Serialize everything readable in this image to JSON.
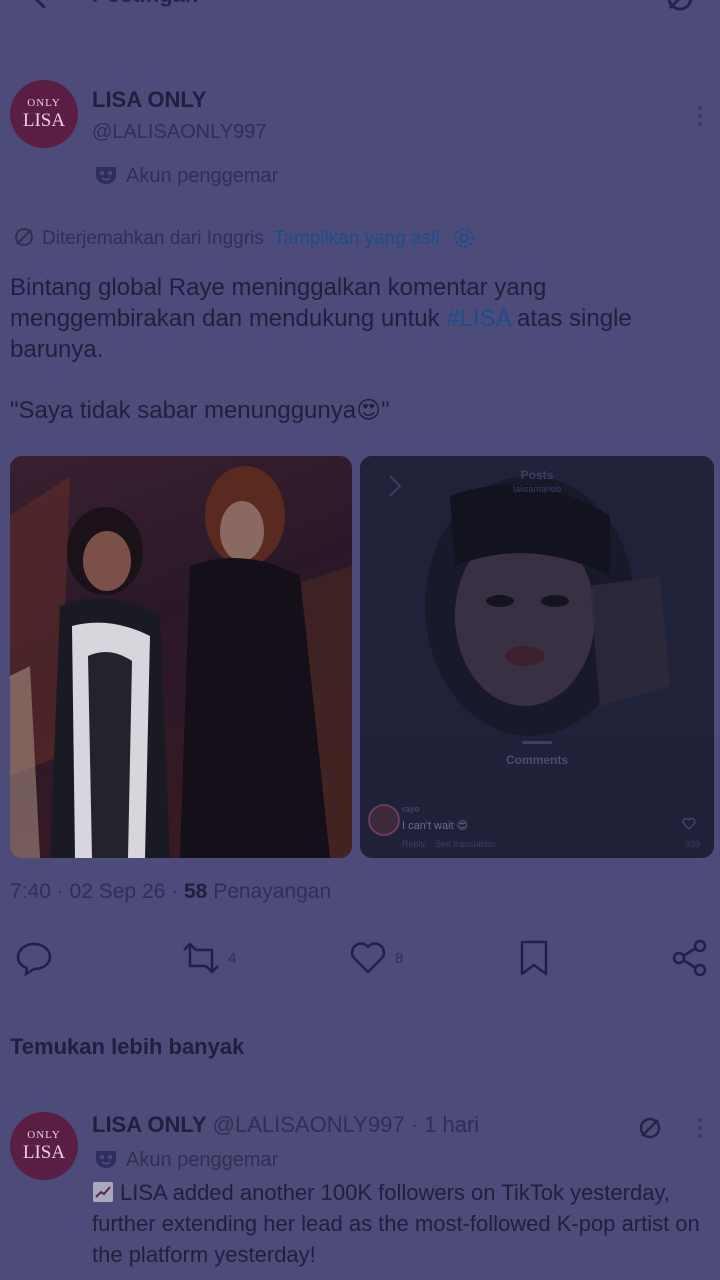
{
  "header": {
    "title": "Postingan"
  },
  "post": {
    "author_name": "LISA ONLY",
    "handle": "@LALISAONLY997",
    "avatar_line1": "ONLY",
    "avatar_line2": "LISA",
    "badge": "Akun penggemar",
    "translated_from": "Diterjemahkan dari Inggris",
    "show_original": "Tampilkan yang asli",
    "text_before_tag": "Bintang global Raye meninggalkan komentar yang menggembirakan dan mendukung untuk ",
    "hashtag": "#LISA",
    "text_after_tag": " atas single barunya.",
    "quote": "\"Saya tidak sabar menunggunya😍\"",
    "time": "7:40",
    "date": "02 Sep 26",
    "views_count": "58",
    "views_label": "Penayangan"
  },
  "embedded_screenshot": {
    "header": "Posts",
    "subheader": "lalisamanob",
    "comments_label": "Comments",
    "comment_user": "raye",
    "comment_text": "I can't wait 😍",
    "reply": "Reply",
    "see_translation": "See translation",
    "like_count": "339"
  },
  "actions": {
    "reposts": "4",
    "likes": "8"
  },
  "discover": {
    "title": "Temukan lebih banyak"
  },
  "tweet2": {
    "author_name": "LISA ONLY",
    "handle": "@LALISAONLY997",
    "separator": "·",
    "age": "1 hari",
    "badge": "Akun penggemar",
    "text": "LISA added another 100K followers on TikTok yesterday, further extending her lead as the most-followed K-pop artist on the platform yesterday!"
  },
  "colors": {
    "overlay_background": "#4c4b7a",
    "link": "#1d4d8a",
    "avatar": "#5a1e45"
  }
}
